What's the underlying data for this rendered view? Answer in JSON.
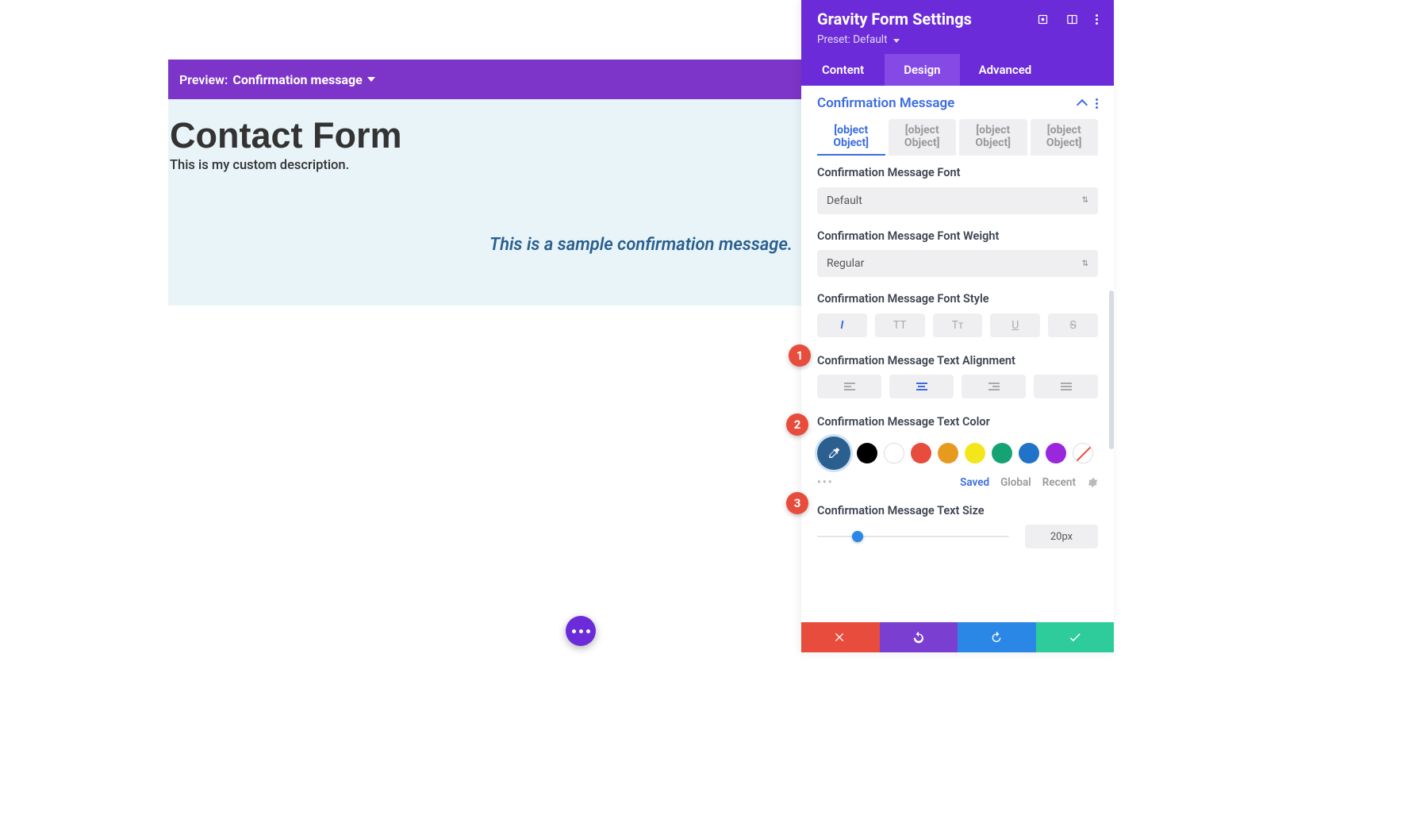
{
  "preview": {
    "label": "Preview:",
    "selected": "Confirmation message"
  },
  "form": {
    "title": "Contact Form",
    "description": "This is my custom description.",
    "confirmation_sample": "This is a sample confirmation message."
  },
  "panel": {
    "title": "Gravity Form Settings",
    "preset_label": "Preset:",
    "preset_value": "Default",
    "tabs": {
      "content": "Content",
      "design": "Design",
      "advanced": "Advanced"
    },
    "section": "Confirmation Message",
    "obj_tabs": [
      "[object Object]",
      "[object Object]",
      "[object Object]",
      "[object Object]"
    ],
    "font": {
      "label": "Confirmation Message Font",
      "value": "Default"
    },
    "font_weight": {
      "label": "Confirmation Message Font Weight",
      "value": "Regular"
    },
    "font_style": {
      "label": "Confirmation Message Font Style",
      "buttons": [
        "I",
        "TT",
        "Tᴛ",
        "U",
        "S"
      ]
    },
    "alignment": {
      "label": "Confirmation Message Text Alignment"
    },
    "color": {
      "label": "Confirmation Message Text Color",
      "current": "#2a5f8f",
      "swatches": [
        "#000000",
        "#ffffff",
        "#e74c3c",
        "#e69b1f",
        "#f3e71c",
        "#15a374",
        "#2073c9",
        "#9b27dc"
      ],
      "tabs": {
        "saved": "Saved",
        "global": "Global",
        "recent": "Recent"
      }
    },
    "size": {
      "label": "Confirmation Message Text Size",
      "value": "20px",
      "percent": 20
    }
  },
  "badges": {
    "b1": "1",
    "b2": "2",
    "b3": "3"
  }
}
